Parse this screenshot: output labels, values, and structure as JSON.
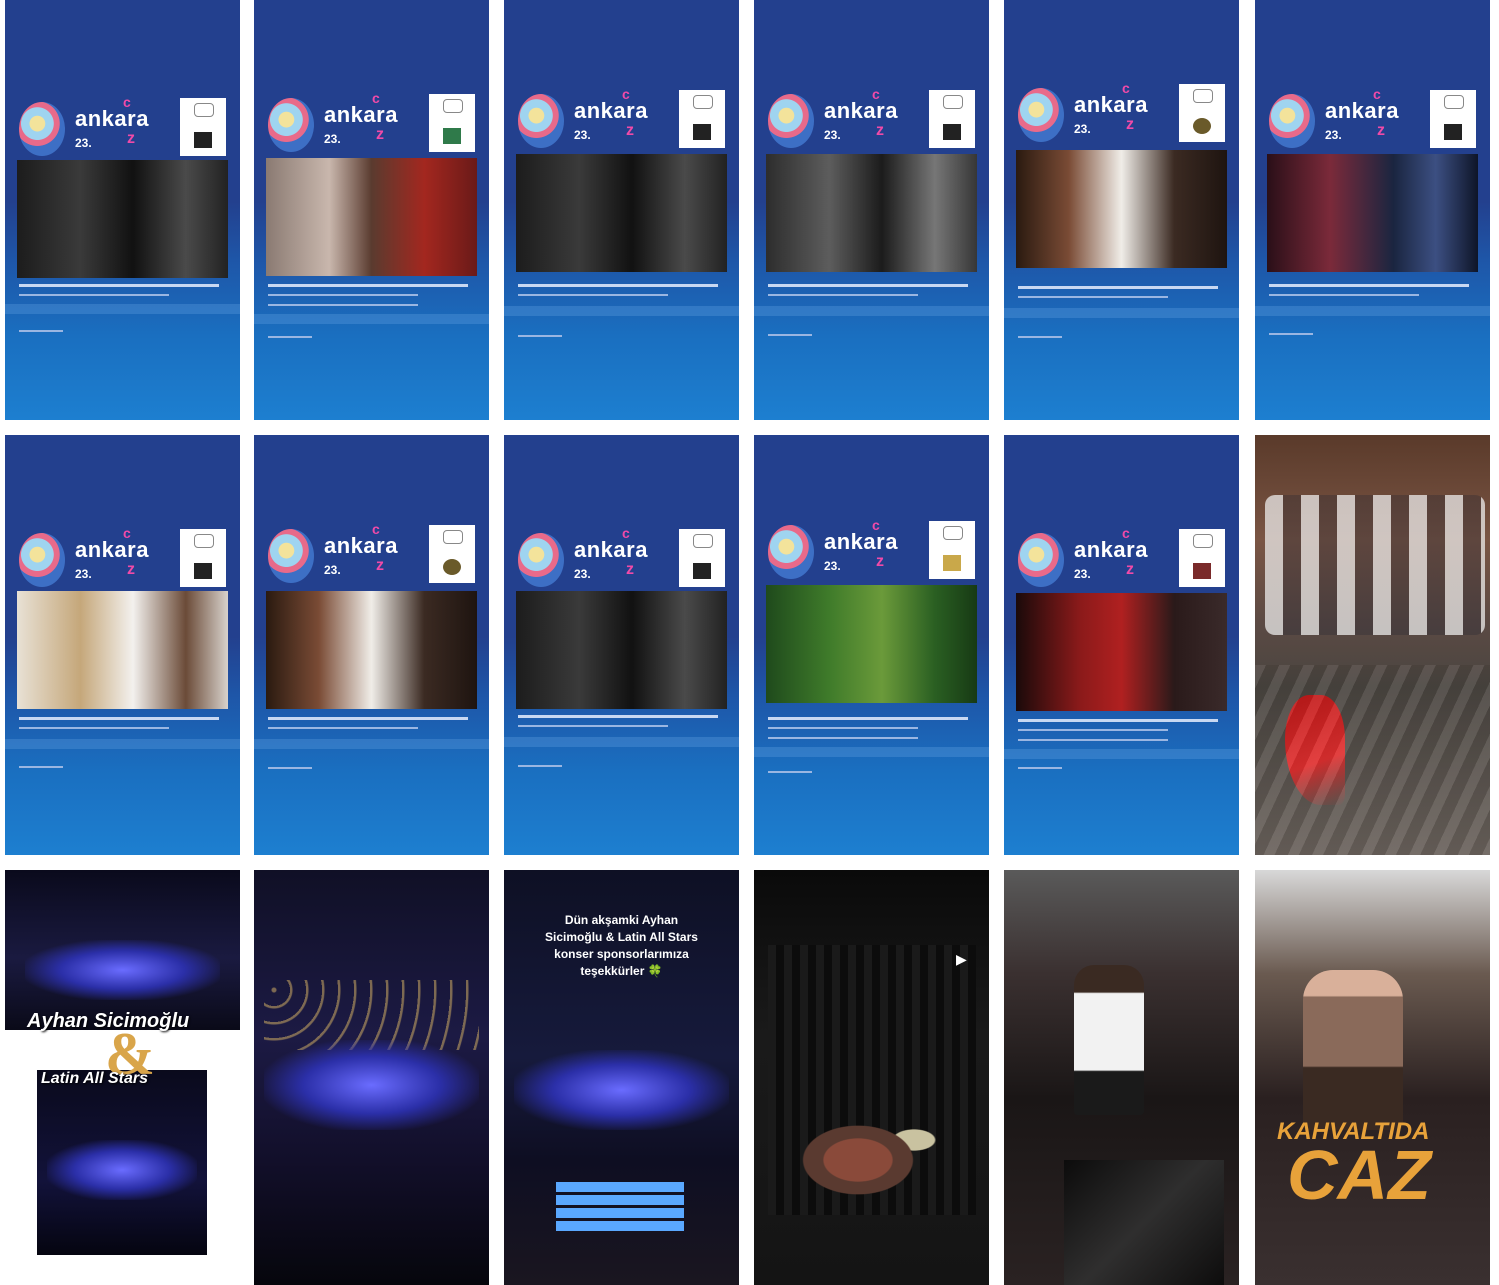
{
  "poster_brand": {
    "logo_word": "ankara",
    "logo_c": "c",
    "logo_number": "23.",
    "logo_z": "z"
  },
  "overlays": {
    "ayhan": "Ayhan Sicimoğlu",
    "ampersand": "&",
    "latin": "Latin All Stars",
    "story_line1": "Dün akşamki Ayhan",
    "story_line2": "Sicimoğlu & Latin All Stars",
    "story_line3": "konser sponsorlarımıza",
    "story_line4": "teşekkürler 🍀",
    "kahvalti": "KAHVALTIDA",
    "caz": "CAZ"
  },
  "colors": {
    "poster_blue": "#23408e",
    "accent_pink": "#f04aa8",
    "caz_orange": "#e8a23a"
  }
}
